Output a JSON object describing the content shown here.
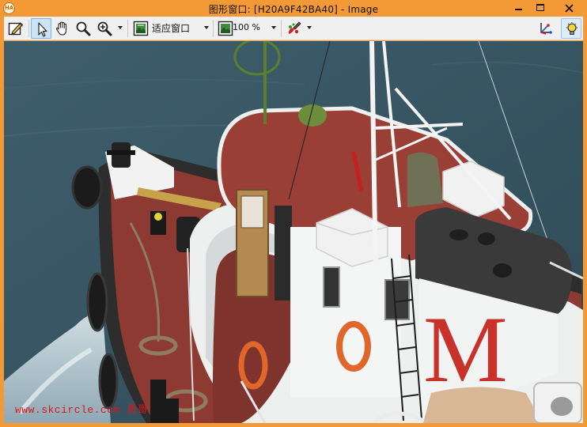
{
  "window": {
    "title_prefix": "图形窗口: ",
    "window_id": "[H20A9F42BA40]",
    "title_sep": " - ",
    "title_suffix": "Image",
    "app_icon_text": "HA"
  },
  "toolbar": {
    "fit_mode_label": "适应窗口",
    "zoom_label": "100 %",
    "active_tool": "pointer-icon"
  },
  "icons": [
    "edit-icon",
    "pointer-icon",
    "hand-icon",
    "magnifier-icon",
    "zoom-in-icon",
    "fit-window-icon",
    "zoom-icon",
    "paint-icon",
    "axis-icon",
    "bulb-icon"
  ],
  "image": {
    "watermark": "www.skcircle.com 勇哥",
    "hull_letter": "M"
  },
  "colors": {
    "frame": "#f39a36",
    "sea": "#3b5866",
    "deck": "#8c3a32",
    "hull": "#eef0f0"
  }
}
